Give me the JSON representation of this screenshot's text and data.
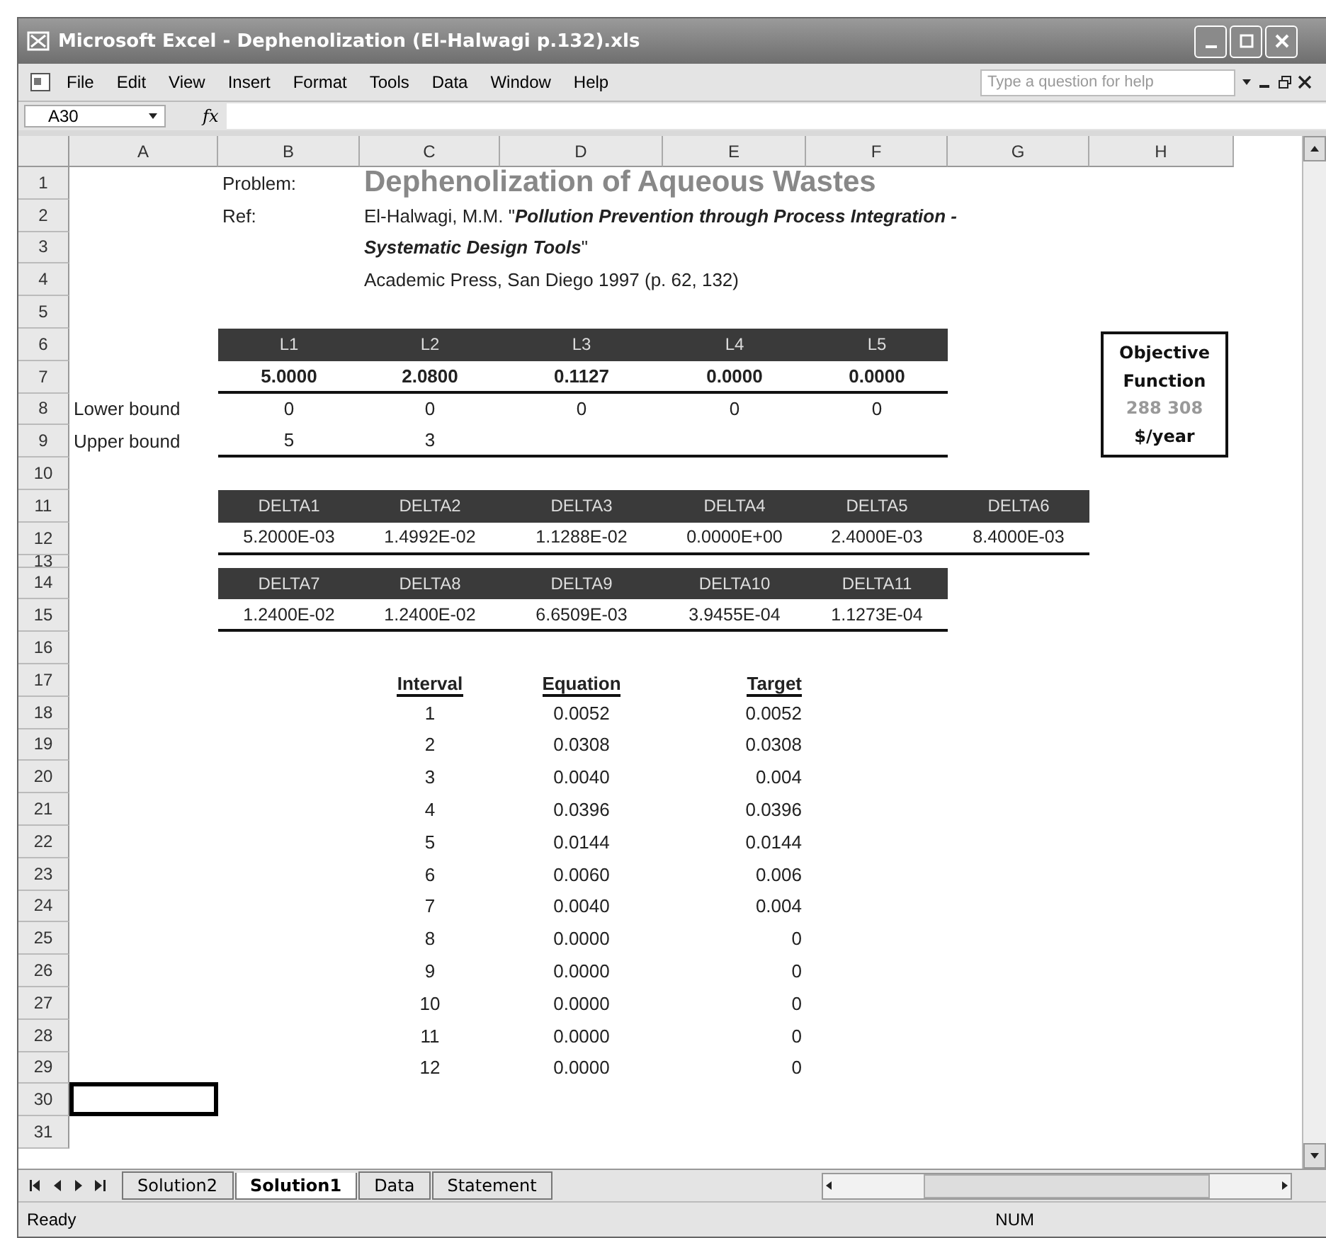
{
  "window": {
    "title": "Microsoft Excel - Dephenolization (El-Halwagi p.132).xls"
  },
  "menu": [
    "File",
    "Edit",
    "View",
    "Insert",
    "Format",
    "Tools",
    "Data",
    "Window",
    "Help"
  ],
  "help_box": {
    "placeholder": "Type a question for help"
  },
  "name_box": {
    "value": "A30"
  },
  "function_label": "fx",
  "columns": [
    "A",
    "B",
    "C",
    "D",
    "E",
    "F",
    "G",
    "H"
  ],
  "row_numbers": [
    "1",
    "2",
    "3",
    "4",
    "5",
    "6",
    "7",
    "8",
    "9",
    "10",
    "11",
    "12",
    "13",
    "14",
    "15",
    "16",
    "17",
    "18",
    "19",
    "20",
    "21",
    "22",
    "23",
    "24",
    "25",
    "26",
    "27",
    "28",
    "29",
    "30",
    "31"
  ],
  "problem": {
    "label": "Problem:",
    "title": "Dephenolization of Aqueous Wastes"
  },
  "ref": {
    "label": "Ref:",
    "lines": [
      "El-Halwagi, M.M. \"**Pollution Prevention through Process Integration -**",
      "**Systematic Design Tools**\"",
      "Academic Press, San Diego 1997  (p. 62, 132)"
    ]
  },
  "variables": {
    "headers": [
      "L1",
      "L2",
      "L3",
      "L4",
      "L5"
    ],
    "values": [
      "5.0000",
      "2.0800",
      "0.1127",
      "0.0000",
      "0.0000"
    ],
    "bounds": [
      {
        "label": "Lower bound",
        "values": [
          "0",
          "0",
          "0",
          "0",
          "0"
        ]
      },
      {
        "label": "Upper bound",
        "values": [
          "5",
          "3"
        ]
      }
    ]
  },
  "deltas": [
    {
      "headers": [
        "DELTA1",
        "DELTA2",
        "DELTA3",
        "DELTA4",
        "DELTA5",
        "DELTA6"
      ],
      "values": [
        "5.2000E-03",
        "1.4992E-02",
        "1.1288E-02",
        "0.0000E+00",
        "2.4000E-03",
        "8.4000E-03"
      ]
    },
    {
      "headers": [
        "DELTA7",
        "DELTA8",
        "DELTA9",
        "DELTA10",
        "DELTA11"
      ],
      "values": [
        "1.2400E-02",
        "1.2400E-02",
        "6.6509E-03",
        "3.9455E-04",
        "1.1273E-04"
      ]
    }
  ],
  "intervals": {
    "columns": [
      "Interval",
      "Equation",
      "Target"
    ],
    "rows": [
      [
        "1",
        "0.0052",
        "0.0052"
      ],
      [
        "2",
        "0.0308",
        "0.0308"
      ],
      [
        "3",
        "0.0040",
        "0.004"
      ],
      [
        "4",
        "0.0396",
        "0.0396"
      ],
      [
        "5",
        "0.0144",
        "0.0144"
      ],
      [
        "6",
        "0.0060",
        "0.006"
      ],
      [
        "7",
        "0.0040",
        "0.004"
      ],
      [
        "8",
        "0.0000",
        "0"
      ],
      [
        "9",
        "0.0000",
        "0"
      ],
      [
        "10",
        "0.0000",
        "0"
      ],
      [
        "11",
        "0.0000",
        "0"
      ],
      [
        "12",
        "0.0000",
        "0"
      ]
    ]
  },
  "objective": {
    "title": [
      "Objective",
      "Function"
    ],
    "value": "288 308",
    "unit": "$/year"
  },
  "sheet_tabs": [
    {
      "label": "Solution2",
      "selected": false
    },
    {
      "label": "Solution1",
      "selected": true
    },
    {
      "label": "Data",
      "selected": false
    },
    {
      "label": "Statement",
      "selected": false
    }
  ],
  "status_bar": {
    "status": "Ready",
    "indicator": "NUM"
  }
}
